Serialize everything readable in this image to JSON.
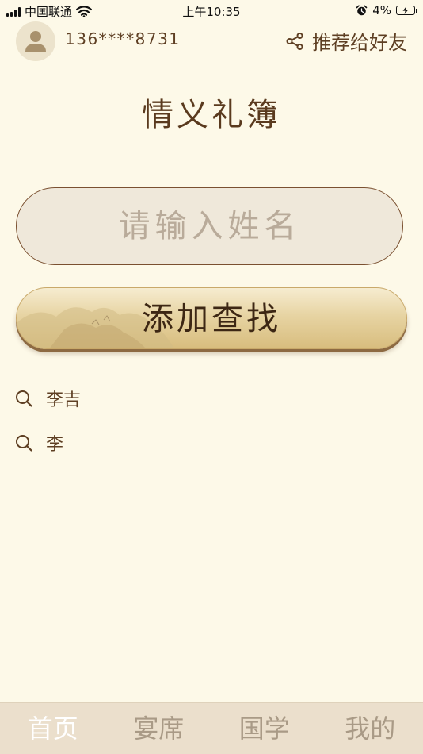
{
  "status_bar": {
    "carrier": "中国联通",
    "time": "上午10:35",
    "battery": "4%"
  },
  "header": {
    "phone": "136****8731",
    "share_label": "推荐给好友"
  },
  "title": "情义礼簿",
  "search": {
    "placeholder": "请输入姓名",
    "button_label": "添加查找"
  },
  "history": [
    {
      "name": "李吉"
    },
    {
      "name": "李"
    }
  ],
  "tabs": [
    {
      "label": "首页",
      "active": true
    },
    {
      "label": "宴席"
    },
    {
      "label": "国学"
    },
    {
      "label": "我的"
    }
  ],
  "colors": {
    "background": "#fdf9e8",
    "text_brown": "#5e3f23",
    "tab_bar": "#ebdfcc",
    "tab_active": "#ffffff",
    "tab_inactive": "#a99a86"
  }
}
